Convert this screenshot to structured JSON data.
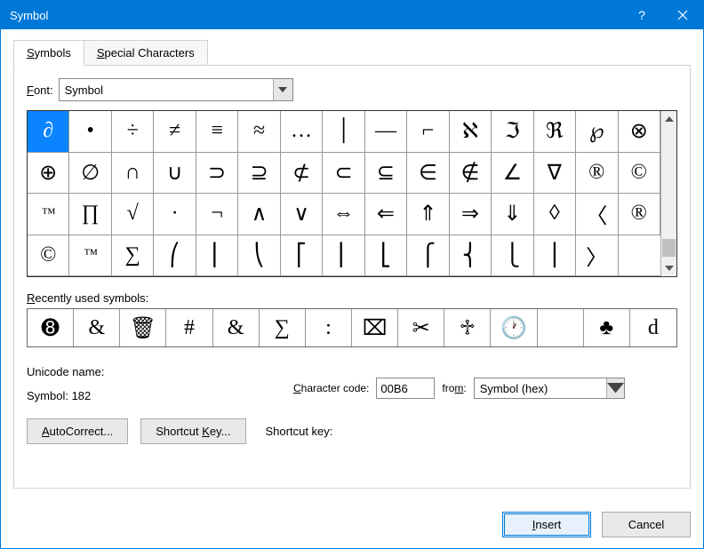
{
  "title": "Symbol",
  "tabs": [
    {
      "label": "Symbols",
      "active": true,
      "u": 0
    },
    {
      "label": "Special Characters",
      "active": false,
      "u": 0
    }
  ],
  "font_label": "Font:",
  "font_label_u": "F",
  "font_value": "Symbol",
  "symbol_cells": [
    "∂",
    "•",
    "÷",
    "≠",
    "≡",
    "≈",
    "…",
    "│",
    "―",
    "⌐",
    "ℵ",
    "ℑ",
    "ℜ",
    "℘",
    "⊗",
    "⊕",
    "∅",
    "∩",
    "∪",
    "⊃",
    "⊇",
    "⊄",
    "⊂",
    "⊆",
    "∈",
    "∉",
    "∠",
    "∇",
    "®",
    "©",
    "™",
    "∏",
    "√",
    "·",
    "¬",
    "∧",
    "∨",
    "⇔",
    "⇐",
    "⇑",
    "⇒",
    "⇓",
    "◊",
    "〈",
    "®",
    "©",
    "™",
    "∑",
    "⎛",
    "⎜",
    "⎝",
    "⎡",
    "⎢",
    "⎣",
    "⎧",
    "⎨",
    "⎩",
    "⎪",
    "〉",
    ""
  ],
  "selected_index": 0,
  "tm_indices": [
    30,
    46
  ],
  "recently_label": "Recently used symbols:",
  "recently_label_u": "R",
  "recent_cells": [
    "➑",
    "&",
    "🗑",
    "#",
    "&",
    "∑",
    ":",
    "⌧",
    "✂",
    "♱",
    "🕐",
    "",
    "♣",
    "d"
  ],
  "unicode_name_label": "Unicode name:",
  "symbol_name": "Symbol: 182",
  "cc_label": "Character code:",
  "cc_value": "00B6",
  "from_label": "from:",
  "from_value": "Symbol (hex)",
  "btn_autocorrect": "AutoCorrect...",
  "btn_shortcut": "Shortcut Key...",
  "shortcut_label": "Shortcut key:",
  "btn_insert": "Insert",
  "btn_cancel": "Cancel"
}
